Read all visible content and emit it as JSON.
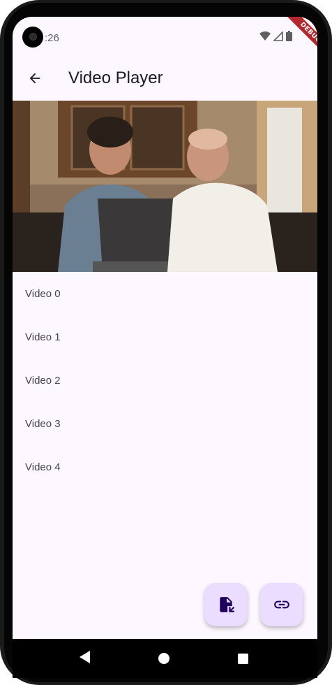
{
  "status_bar": {
    "time": ":26",
    "debug_label": "DEBUG"
  },
  "app_bar": {
    "title": "Video Player",
    "back_icon": "arrow-back-icon"
  },
  "videos": [
    {
      "label": "Video 0"
    },
    {
      "label": "Video 1"
    },
    {
      "label": "Video 2"
    },
    {
      "label": "Video 3"
    },
    {
      "label": "Video 4"
    }
  ],
  "fabs": {
    "file_icon": "file-open-icon",
    "link_icon": "link-icon"
  },
  "colors": {
    "background": "#fdf7ff",
    "fab": "#ebddff",
    "icon": "#21005d",
    "text": "#1d1b20"
  }
}
